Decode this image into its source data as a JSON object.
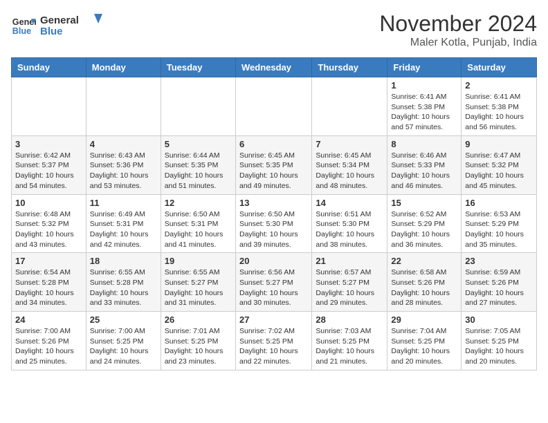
{
  "header": {
    "logo_line1": "General",
    "logo_line2": "Blue",
    "month_year": "November 2024",
    "location": "Maler Kotla, Punjab, India"
  },
  "weekdays": [
    "Sunday",
    "Monday",
    "Tuesday",
    "Wednesday",
    "Thursday",
    "Friday",
    "Saturday"
  ],
  "weeks": [
    [
      {
        "day": "",
        "info": ""
      },
      {
        "day": "",
        "info": ""
      },
      {
        "day": "",
        "info": ""
      },
      {
        "day": "",
        "info": ""
      },
      {
        "day": "",
        "info": ""
      },
      {
        "day": "1",
        "info": "Sunrise: 6:41 AM\nSunset: 5:38 PM\nDaylight: 10 hours and 57 minutes."
      },
      {
        "day": "2",
        "info": "Sunrise: 6:41 AM\nSunset: 5:38 PM\nDaylight: 10 hours and 56 minutes."
      }
    ],
    [
      {
        "day": "3",
        "info": "Sunrise: 6:42 AM\nSunset: 5:37 PM\nDaylight: 10 hours and 54 minutes."
      },
      {
        "day": "4",
        "info": "Sunrise: 6:43 AM\nSunset: 5:36 PM\nDaylight: 10 hours and 53 minutes."
      },
      {
        "day": "5",
        "info": "Sunrise: 6:44 AM\nSunset: 5:35 PM\nDaylight: 10 hours and 51 minutes."
      },
      {
        "day": "6",
        "info": "Sunrise: 6:45 AM\nSunset: 5:35 PM\nDaylight: 10 hours and 49 minutes."
      },
      {
        "day": "7",
        "info": "Sunrise: 6:45 AM\nSunset: 5:34 PM\nDaylight: 10 hours and 48 minutes."
      },
      {
        "day": "8",
        "info": "Sunrise: 6:46 AM\nSunset: 5:33 PM\nDaylight: 10 hours and 46 minutes."
      },
      {
        "day": "9",
        "info": "Sunrise: 6:47 AM\nSunset: 5:32 PM\nDaylight: 10 hours and 45 minutes."
      }
    ],
    [
      {
        "day": "10",
        "info": "Sunrise: 6:48 AM\nSunset: 5:32 PM\nDaylight: 10 hours and 43 minutes."
      },
      {
        "day": "11",
        "info": "Sunrise: 6:49 AM\nSunset: 5:31 PM\nDaylight: 10 hours and 42 minutes."
      },
      {
        "day": "12",
        "info": "Sunrise: 6:50 AM\nSunset: 5:31 PM\nDaylight: 10 hours and 41 minutes."
      },
      {
        "day": "13",
        "info": "Sunrise: 6:50 AM\nSunset: 5:30 PM\nDaylight: 10 hours and 39 minutes."
      },
      {
        "day": "14",
        "info": "Sunrise: 6:51 AM\nSunset: 5:30 PM\nDaylight: 10 hours and 38 minutes."
      },
      {
        "day": "15",
        "info": "Sunrise: 6:52 AM\nSunset: 5:29 PM\nDaylight: 10 hours and 36 minutes."
      },
      {
        "day": "16",
        "info": "Sunrise: 6:53 AM\nSunset: 5:29 PM\nDaylight: 10 hours and 35 minutes."
      }
    ],
    [
      {
        "day": "17",
        "info": "Sunrise: 6:54 AM\nSunset: 5:28 PM\nDaylight: 10 hours and 34 minutes."
      },
      {
        "day": "18",
        "info": "Sunrise: 6:55 AM\nSunset: 5:28 PM\nDaylight: 10 hours and 33 minutes."
      },
      {
        "day": "19",
        "info": "Sunrise: 6:55 AM\nSunset: 5:27 PM\nDaylight: 10 hours and 31 minutes."
      },
      {
        "day": "20",
        "info": "Sunrise: 6:56 AM\nSunset: 5:27 PM\nDaylight: 10 hours and 30 minutes."
      },
      {
        "day": "21",
        "info": "Sunrise: 6:57 AM\nSunset: 5:27 PM\nDaylight: 10 hours and 29 minutes."
      },
      {
        "day": "22",
        "info": "Sunrise: 6:58 AM\nSunset: 5:26 PM\nDaylight: 10 hours and 28 minutes."
      },
      {
        "day": "23",
        "info": "Sunrise: 6:59 AM\nSunset: 5:26 PM\nDaylight: 10 hours and 27 minutes."
      }
    ],
    [
      {
        "day": "24",
        "info": "Sunrise: 7:00 AM\nSunset: 5:26 PM\nDaylight: 10 hours and 25 minutes."
      },
      {
        "day": "25",
        "info": "Sunrise: 7:00 AM\nSunset: 5:25 PM\nDaylight: 10 hours and 24 minutes."
      },
      {
        "day": "26",
        "info": "Sunrise: 7:01 AM\nSunset: 5:25 PM\nDaylight: 10 hours and 23 minutes."
      },
      {
        "day": "27",
        "info": "Sunrise: 7:02 AM\nSunset: 5:25 PM\nDaylight: 10 hours and 22 minutes."
      },
      {
        "day": "28",
        "info": "Sunrise: 7:03 AM\nSunset: 5:25 PM\nDaylight: 10 hours and 21 minutes."
      },
      {
        "day": "29",
        "info": "Sunrise: 7:04 AM\nSunset: 5:25 PM\nDaylight: 10 hours and 20 minutes."
      },
      {
        "day": "30",
        "info": "Sunrise: 7:05 AM\nSunset: 5:25 PM\nDaylight: 10 hours and 20 minutes."
      }
    ]
  ]
}
